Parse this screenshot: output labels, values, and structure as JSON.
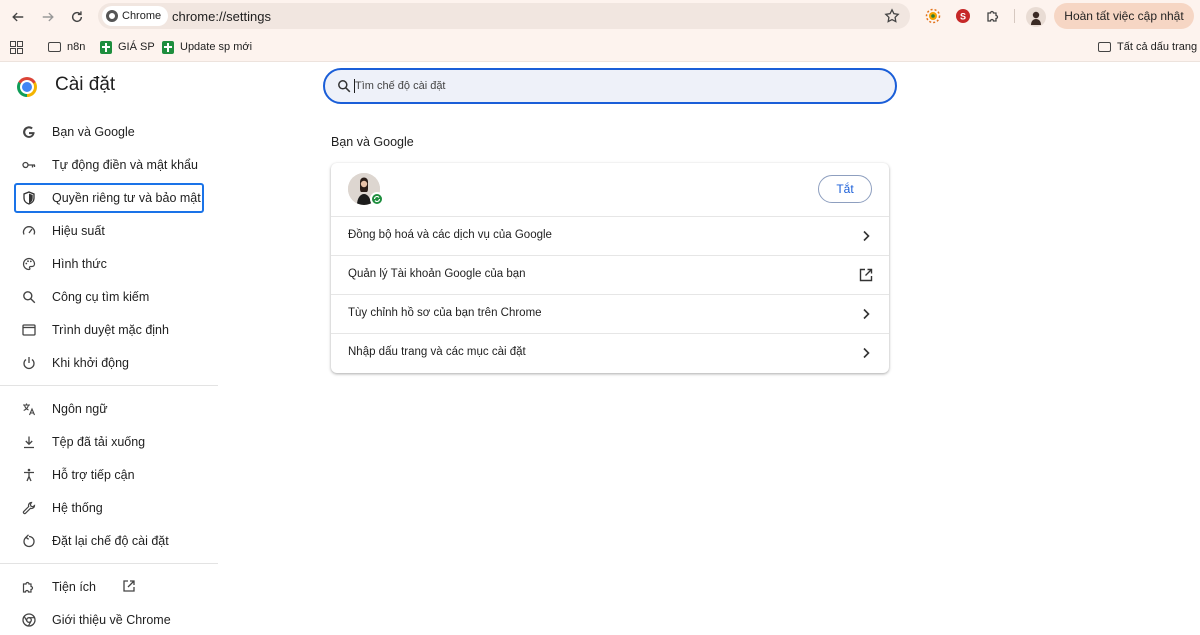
{
  "browser": {
    "site_chip": "Chrome",
    "url": "chrome://settings",
    "update_button": "Hoàn tất việc cập nhật"
  },
  "bookmarks": {
    "items": [
      {
        "label": "n8n",
        "icon": "folder-icon"
      },
      {
        "label": "GIÁ SP",
        "icon": "sheets-icon"
      },
      {
        "label": "Update sp mới",
        "icon": "sheets-icon"
      }
    ],
    "all_bookmarks": "Tất cả dấu trang"
  },
  "settings": {
    "title": "Cài đặt",
    "nav": [
      {
        "label": "Bạn và Google",
        "icon": "google-icon"
      },
      {
        "label": "Tự động điền và mật khẩu",
        "icon": "key-icon"
      },
      {
        "label": "Quyền riêng tư và bảo mật",
        "icon": "shield-icon",
        "active": true
      },
      {
        "label": "Hiệu suất",
        "icon": "speedometer-icon"
      },
      {
        "label": "Hình thức",
        "icon": "palette-icon"
      },
      {
        "label": "Công cụ tìm kiếm",
        "icon": "search-icon"
      },
      {
        "label": "Trình duyệt mặc định",
        "icon": "browser-window-icon"
      },
      {
        "label": "Khi khởi động",
        "icon": "power-icon"
      },
      {
        "label": "Ngôn ngữ",
        "icon": "translate-icon"
      },
      {
        "label": "Tệp đã tải xuống",
        "icon": "download-icon"
      },
      {
        "label": "Hỗ trợ tiếp cận",
        "icon": "accessibility-icon"
      },
      {
        "label": "Hệ thống",
        "icon": "wrench-icon"
      },
      {
        "label": "Đặt lại chế độ cài đặt",
        "icon": "reset-icon"
      },
      {
        "label": "Tiện ích",
        "icon": "puzzle-icon"
      },
      {
        "label": "Giới thiệu về Chrome",
        "icon": "chrome-icon"
      }
    ]
  },
  "search": {
    "placeholder": "Tìm chế độ cài đặt"
  },
  "you_and_google": {
    "section_title": "Bạn và Google",
    "off_button": "Tắt",
    "rows": [
      {
        "label": "Đồng bộ hoá và các dịch vụ của Google",
        "icon": "chevron-right-icon"
      },
      {
        "label": "Quản lý Tài khoản Google của bạn",
        "icon": "external-link-icon"
      },
      {
        "label": "Tùy chỉnh hồ sơ của bạn trên Chrome",
        "icon": "chevron-right-icon"
      },
      {
        "label": "Nhập dấu trang và các mục cài đặt",
        "icon": "chevron-right-icon"
      }
    ]
  },
  "colors": {
    "accent": "#1a73e8",
    "toolbar_bg": "#fdf3ee",
    "update_button_bg": "#f6d6c4",
    "sync_badge": "#1e8e3e"
  }
}
